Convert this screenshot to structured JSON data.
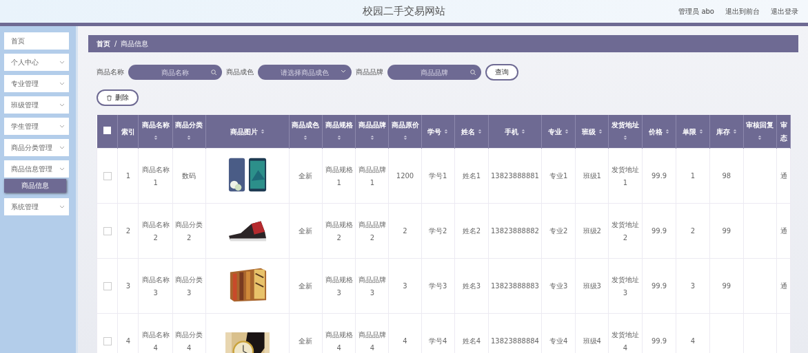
{
  "header": {
    "title": "校园二手交易网站",
    "user": "管理员 abo",
    "links": [
      "退出到前台",
      "退出登录"
    ]
  },
  "sidebar": {
    "items": [
      {
        "label": "首页",
        "expandable": false
      },
      {
        "label": "个人中心",
        "expandable": true
      },
      {
        "label": "专业管理",
        "expandable": true
      },
      {
        "label": "班级管理",
        "expandable": true
      },
      {
        "label": "学生管理",
        "expandable": true
      },
      {
        "label": "商品分类管理",
        "expandable": true
      },
      {
        "label": "商品信息管理",
        "expandable": true,
        "children": [
          {
            "label": "商品信息",
            "selected": true
          }
        ]
      },
      {
        "label": "系统管理",
        "expandable": true
      }
    ]
  },
  "breadcrumb": {
    "items": [
      "首页",
      "商品信息"
    ],
    "separator": "/"
  },
  "filters": [
    {
      "kind": "text",
      "label": "商品名称",
      "placeholder": "商品名称"
    },
    {
      "kind": "select",
      "label": "商品成色",
      "placeholder": "请选择商品成色"
    },
    {
      "kind": "text",
      "label": "商品品牌",
      "placeholder": "商品品牌"
    }
  ],
  "query_button": "查询",
  "delete_button": "删除",
  "table": {
    "select_all_checked": false,
    "columns": [
      {
        "label": "索引",
        "sortable": false
      },
      {
        "label": "商品名称",
        "sortable": true
      },
      {
        "label": "商品分类",
        "sortable": true
      },
      {
        "label": "商品图片",
        "sortable": true
      },
      {
        "label": "商品成色",
        "sortable": true
      },
      {
        "label": "商品规格",
        "sortable": true
      },
      {
        "label": "商品品牌",
        "sortable": true
      },
      {
        "label": "商品原价",
        "sortable": true
      },
      {
        "label": "学号",
        "sortable": true
      },
      {
        "label": "姓名",
        "sortable": true
      },
      {
        "label": "手机",
        "sortable": true
      },
      {
        "label": "专业",
        "sortable": true
      },
      {
        "label": "班级",
        "sortable": true
      },
      {
        "label": "发货地址",
        "sortable": true
      },
      {
        "label": "价格",
        "sortable": true
      },
      {
        "label": "单限",
        "sortable": true
      },
      {
        "label": "库存",
        "sortable": true
      },
      {
        "label": "审核回复",
        "sortable": true
      },
      {
        "label": "审态",
        "sortable": false
      }
    ],
    "rows": [
      {
        "checked": false,
        "cells": [
          "1",
          "商品名称1",
          "数码",
          {
            "kind": "picture"
          },
          "全新",
          "商品规格1",
          "商品品牌1",
          "1200",
          "学号1",
          "姓名1",
          "13823888881",
          "专业1",
          "班级1",
          "发货地址1",
          "99.9",
          "1",
          "98",
          null,
          "通"
        ]
      },
      {
        "checked": false,
        "cells": [
          "2",
          "商品名称2",
          "商品分类2",
          {
            "kind": "picture"
          },
          "全新",
          "商品规格2",
          "商品品牌2",
          "2",
          "学号2",
          "姓名2",
          "13823888882",
          "专业2",
          "班级2",
          "发货地址2",
          "99.9",
          "2",
          "99",
          null,
          "通"
        ]
      },
      {
        "checked": false,
        "cells": [
          "3",
          "商品名称3",
          "商品分类3",
          {
            "kind": "picture"
          },
          "全新",
          "商品规格3",
          "商品品牌3",
          "3",
          "学号3",
          "姓名3",
          "13823888883",
          "专业3",
          "班级3",
          "发货地址3",
          "99.9",
          "3",
          "99",
          null,
          "通"
        ]
      },
      {
        "checked": false,
        "cells": [
          "4",
          "商品名称4",
          "商品分类4",
          {
            "kind": "picture"
          },
          "全新",
          "商品规格4",
          "商品品牌4",
          "4",
          "学号4",
          "姓名4",
          "13823888884",
          "专业4",
          "班级4",
          "发货地址4",
          "99.9",
          "4",
          null,
          null,
          null
        ]
      }
    ]
  }
}
